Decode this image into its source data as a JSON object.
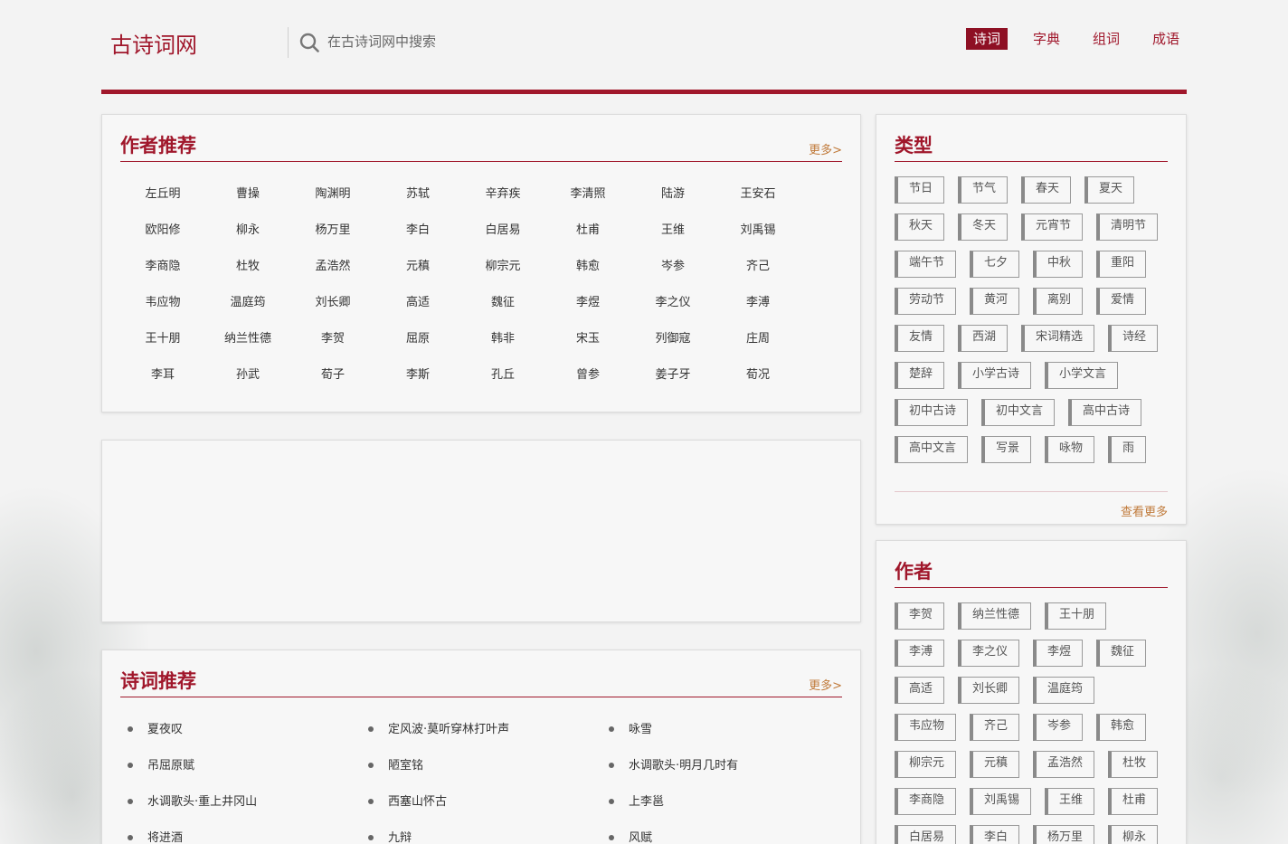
{
  "site": {
    "title": "古诗词网"
  },
  "search": {
    "placeholder": "在古诗词网中搜索"
  },
  "nav": [
    {
      "label": "诗词",
      "active": true
    },
    {
      "label": "字典"
    },
    {
      "label": "组词"
    },
    {
      "label": "成语"
    }
  ],
  "authors_panel": {
    "title": "作者推荐",
    "more": "更多>",
    "authors": [
      "左丘明",
      "曹操",
      "陶渊明",
      "苏轼",
      "辛弃疾",
      "李清照",
      "陆游",
      "王安石",
      "欧阳修",
      "柳永",
      "杨万里",
      "李白",
      "白居易",
      "杜甫",
      "王维",
      "刘禹锡",
      "李商隐",
      "杜牧",
      "孟浩然",
      "元稹",
      "柳宗元",
      "韩愈",
      "岑参",
      "齐己",
      "韦应物",
      "温庭筠",
      "刘长卿",
      "高适",
      "魏征",
      "李煜",
      "李之仪",
      "李溥",
      "王十朋",
      "纳兰性德",
      "李贺",
      "屈原",
      "韩非",
      "宋玉",
      "列御寇",
      "庄周",
      "李耳",
      "孙武",
      "荀子",
      "李斯",
      "孔丘",
      "曾参",
      "姜子牙",
      "荀况"
    ]
  },
  "poems_panel": {
    "title": "诗词推荐",
    "more": "更多>",
    "poems": [
      "夏夜叹",
      "定风波·莫听穿林打叶声",
      "咏雪",
      "吊屈原赋",
      "陋室铭",
      "水调歌头·明月几时有",
      "水调歌头·重上井冈山",
      "西塞山怀古",
      "上李邕",
      "将进酒",
      "九辩",
      "风赋"
    ]
  },
  "types_panel": {
    "title": "类型",
    "tags": [
      "节日",
      "节气",
      "春天",
      "夏天",
      "秋天",
      "冬天",
      "元宵节",
      "清明节",
      "端午节",
      "七夕",
      "中秋",
      "重阳",
      "劳动节",
      "黄河",
      "离别",
      "爱情",
      "友情",
      "西湖",
      "宋词精选",
      "诗经",
      "楚辞",
      "小学古诗",
      "小学文言",
      "初中古诗",
      "初中文言",
      "高中古诗",
      "高中文言",
      "写景",
      "咏物",
      "雨"
    ],
    "see_more": "查看更多"
  },
  "authors_side_panel": {
    "title": "作者",
    "tags": [
      "李贺",
      "纳兰性德",
      "王十朋",
      "李溥",
      "李之仪",
      "李煜",
      "魏征",
      "高适",
      "刘长卿",
      "温庭筠",
      "韦应物",
      "齐己",
      "岑参",
      "韩愈",
      "柳宗元",
      "元稹",
      "孟浩然",
      "杜牧",
      "李商隐",
      "刘禹锡",
      "王维",
      "杜甫",
      "白居易",
      "李白",
      "杨万里",
      "柳永"
    ]
  }
}
